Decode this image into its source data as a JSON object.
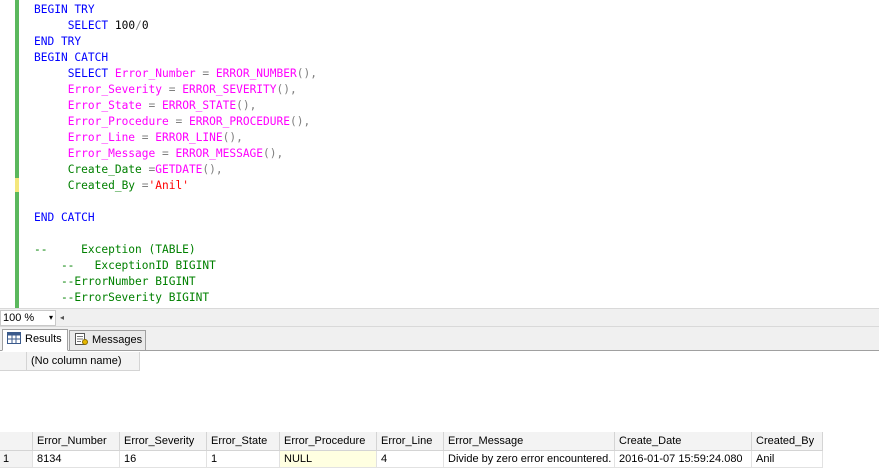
{
  "editor": {
    "lines": [
      [
        {
          "t": "BEGIN TRY",
          "c": "kw"
        }
      ],
      [
        {
          "t": "     "
        },
        {
          "t": "SELECT",
          "c": "kw"
        },
        {
          "t": " 100"
        },
        {
          "t": "/",
          "c": "op"
        },
        {
          "t": "0"
        }
      ],
      [
        {
          "t": "END TRY",
          "c": "kw"
        }
      ],
      [
        {
          "t": "BEGIN CATCH",
          "c": "kw"
        }
      ],
      [
        {
          "t": "     "
        },
        {
          "t": "SELECT",
          "c": "kw"
        },
        {
          "t": " Error_Number ",
          "c": "fn"
        },
        {
          "t": "=",
          "c": "op"
        },
        {
          "t": " ERROR_NUMBER",
          "c": "fn"
        },
        {
          "t": "(),",
          "c": "op"
        }
      ],
      [
        {
          "t": "     "
        },
        {
          "t": "Error_Severity ",
          "c": "fn"
        },
        {
          "t": "=",
          "c": "op"
        },
        {
          "t": " ERROR_SEVERITY",
          "c": "fn"
        },
        {
          "t": "(),",
          "c": "op"
        }
      ],
      [
        {
          "t": "     "
        },
        {
          "t": "Error_State ",
          "c": "fn"
        },
        {
          "t": "=",
          "c": "op"
        },
        {
          "t": " ERROR_STATE",
          "c": "fn"
        },
        {
          "t": "(),",
          "c": "op"
        }
      ],
      [
        {
          "t": "     "
        },
        {
          "t": "Error_Procedure ",
          "c": "fn"
        },
        {
          "t": "=",
          "c": "op"
        },
        {
          "t": " ERROR_PROCEDURE",
          "c": "fn"
        },
        {
          "t": "(),",
          "c": "op"
        }
      ],
      [
        {
          "t": "     "
        },
        {
          "t": "Error_Line ",
          "c": "fn"
        },
        {
          "t": "=",
          "c": "op"
        },
        {
          "t": " ERROR_LINE",
          "c": "fn"
        },
        {
          "t": "(),",
          "c": "op"
        }
      ],
      [
        {
          "t": "     "
        },
        {
          "t": "Error_Message ",
          "c": "fn"
        },
        {
          "t": "=",
          "c": "op"
        },
        {
          "t": " ERROR_MESSAGE",
          "c": "fn"
        },
        {
          "t": "(),",
          "c": "op"
        }
      ],
      [
        {
          "t": "     "
        },
        {
          "t": "Create_Date ",
          "c": "cm"
        },
        {
          "t": "=",
          "c": "op"
        },
        {
          "t": "GETDATE",
          "c": "fn"
        },
        {
          "t": "(),",
          "c": "op"
        }
      ],
      [
        {
          "t": "     "
        },
        {
          "t": "Created_By ",
          "c": "cm"
        },
        {
          "t": "=",
          "c": "op"
        },
        {
          "t": "'Anil'",
          "c": "str"
        }
      ],
      [
        {
          "t": ""
        }
      ],
      [
        {
          "t": "END CATCH",
          "c": "kw"
        }
      ],
      [
        {
          "t": ""
        }
      ],
      [
        {
          "t": "--     Exception (TABLE)",
          "c": "cm"
        }
      ],
      [
        {
          "t": "    --   ExceptionID BIGINT",
          "c": "cm"
        }
      ],
      [
        {
          "t": "    --ErrorNumber BIGINT",
          "c": "cm"
        }
      ],
      [
        {
          "t": "    --ErrorSeverity BIGINT",
          "c": "cm"
        }
      ]
    ]
  },
  "zoom": {
    "value": "100 %",
    "arrow": "▾",
    "scroll": "◂"
  },
  "tabs": {
    "results": "Results",
    "messages": "Messages"
  },
  "grid1": {
    "columns": [
      "(No column name)"
    ],
    "rows": []
  },
  "grid2": {
    "columns": [
      "Error_Number",
      "Error_Severity",
      "Error_State",
      "Error_Procedure",
      "Error_Line",
      "Error_Message",
      "Create_Date",
      "Created_By"
    ],
    "rows": [
      {
        "num": "1",
        "cells": [
          "8134",
          "16",
          "1",
          "NULL",
          "4",
          "Divide by zero error encountered.",
          "2016-01-07 15:59:24.080",
          "Anil"
        ]
      }
    ]
  }
}
